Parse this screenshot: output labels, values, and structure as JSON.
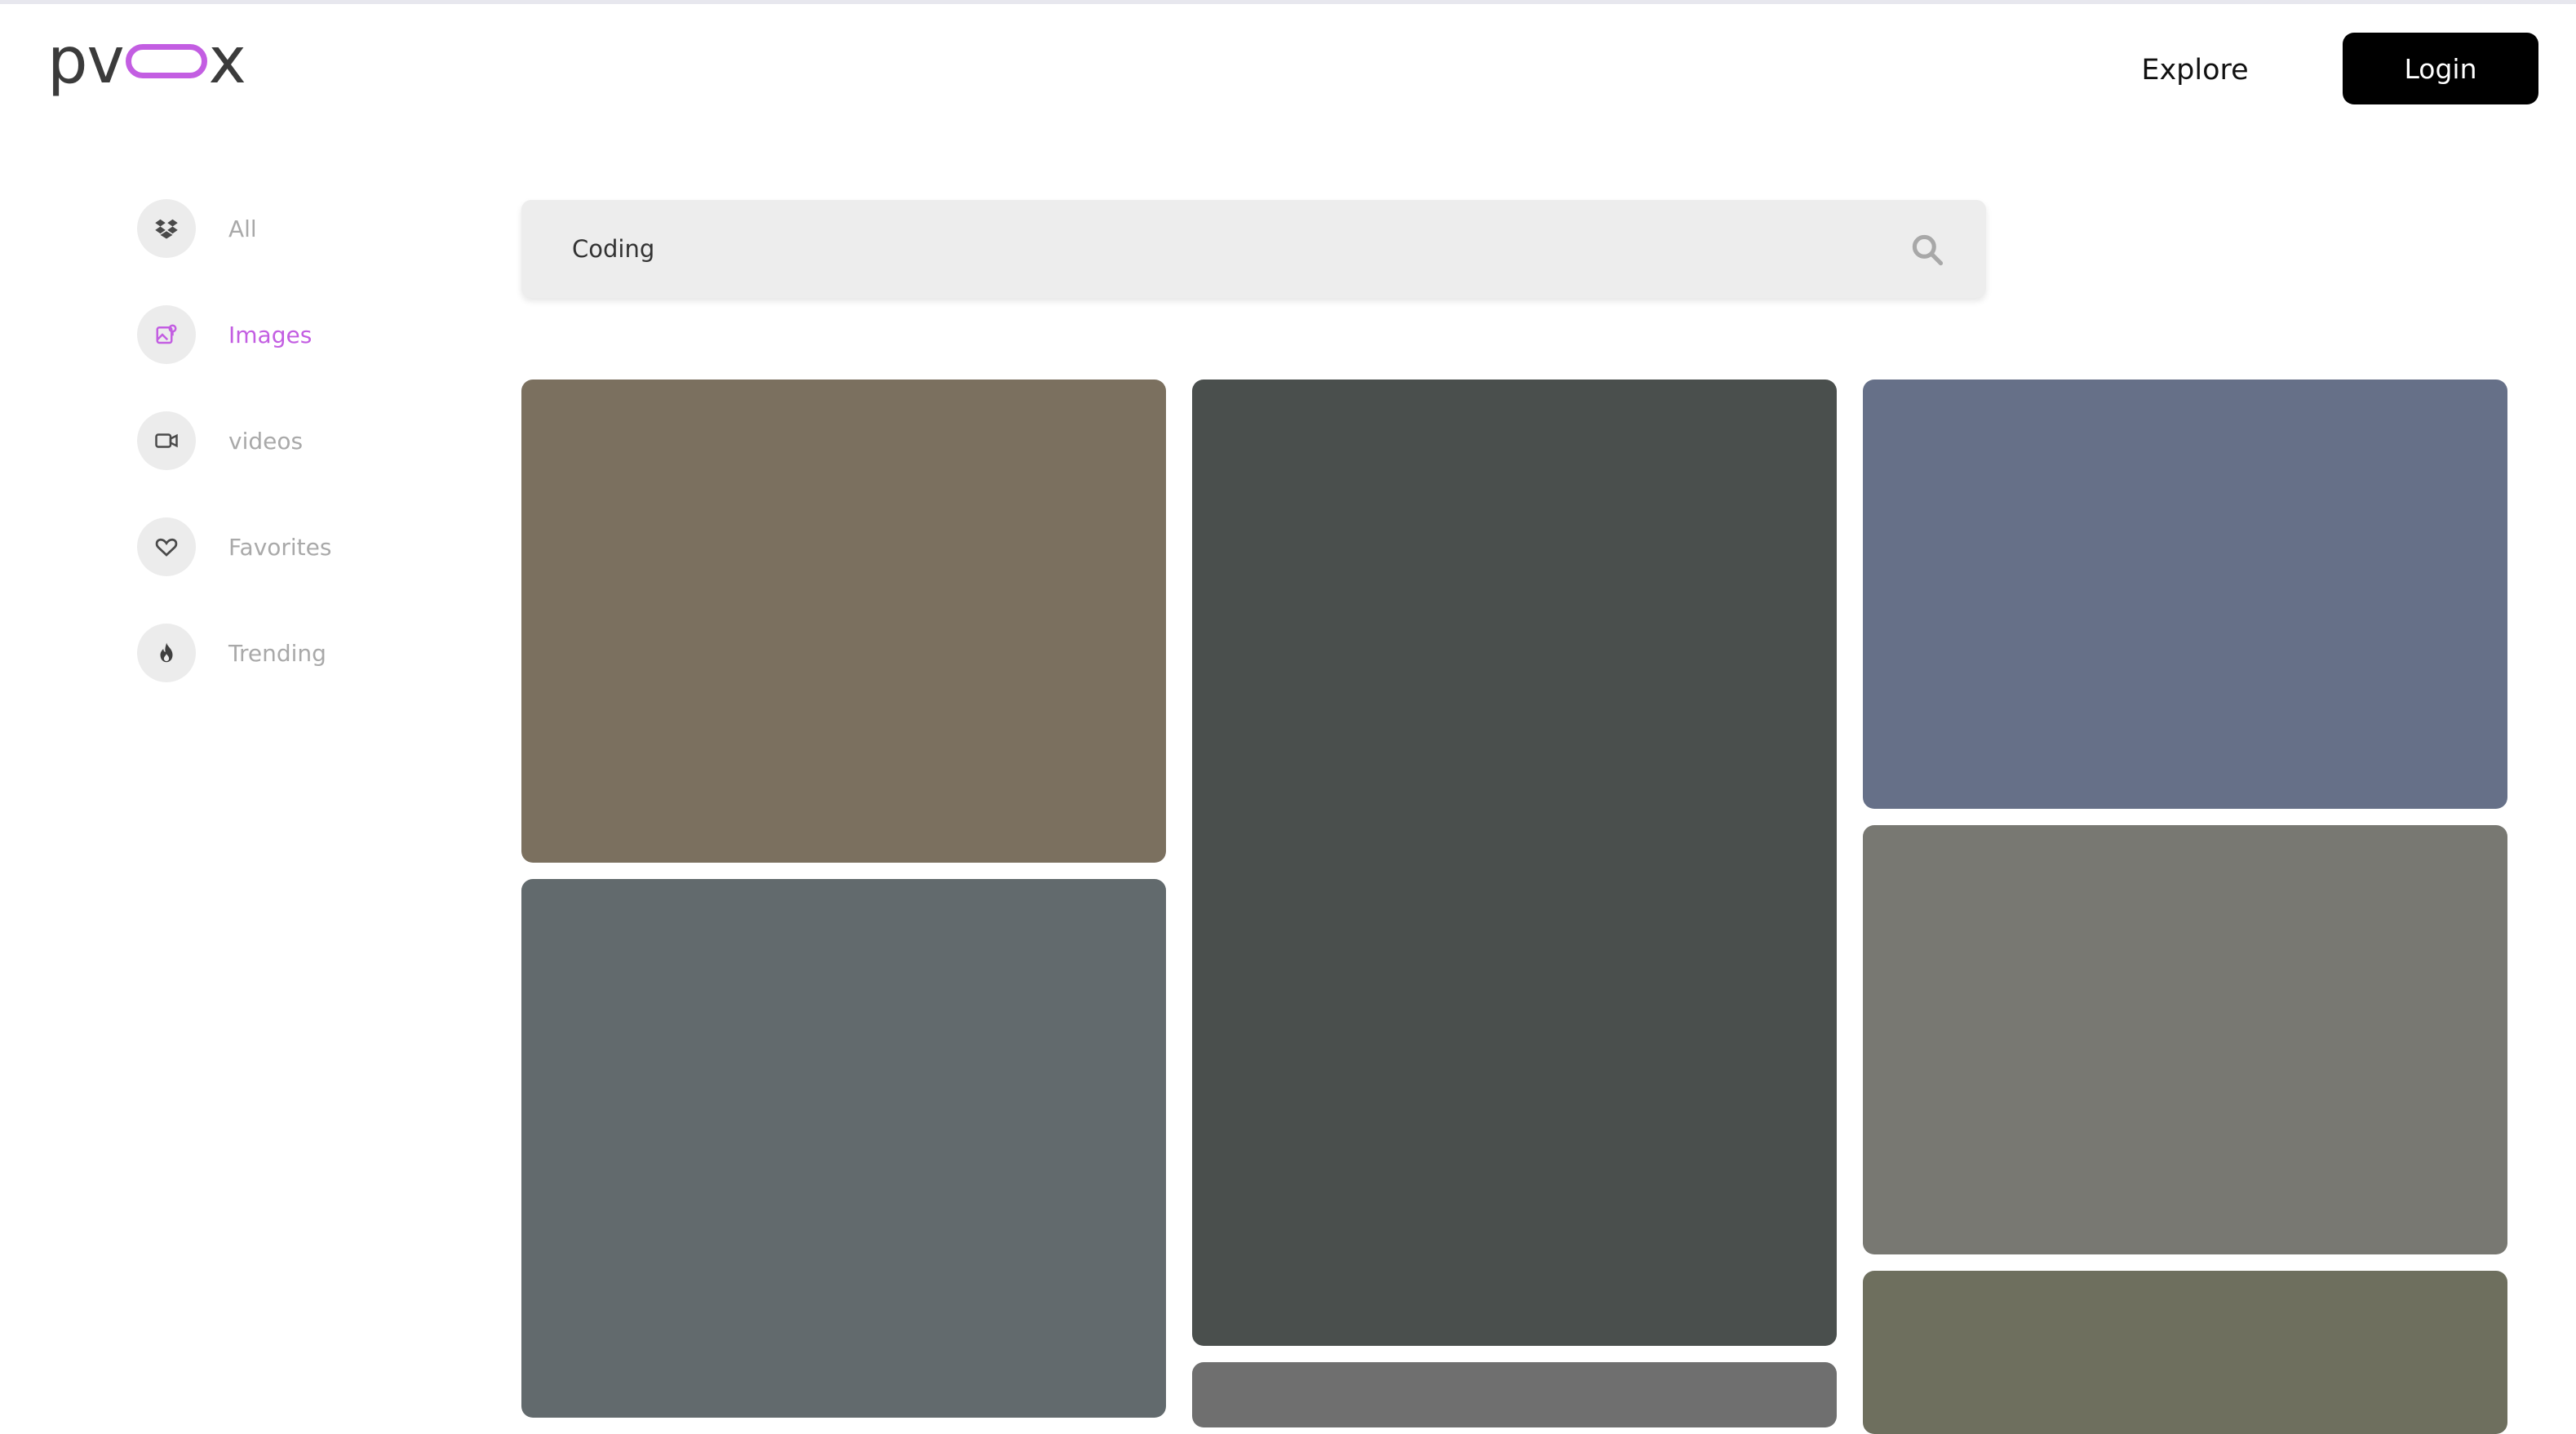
{
  "logo": {
    "prefix": "pv",
    "suffix": "x",
    "accent": "#c35ee2"
  },
  "header": {
    "explore_label": "Explore",
    "login_label": "Login"
  },
  "sidebar": {
    "items": [
      {
        "label": "All",
        "icon": "dropbox-icon"
      },
      {
        "label": "Images",
        "icon": "image-icon",
        "active": true
      },
      {
        "label": "videos",
        "icon": "video-icon"
      },
      {
        "label": "Favorites",
        "icon": "heart-icon"
      },
      {
        "label": "Trending",
        "icon": "fire-icon"
      }
    ]
  },
  "search": {
    "value": "Coding",
    "icon": "search-icon"
  },
  "gallery": {
    "tiles": [
      {
        "color": "#7b705f"
      },
      {
        "color": "#626a6d"
      },
      {
        "color": "#4a4f4d"
      },
      {
        "color": "#6f6f6f"
      },
      {
        "color": "#667088"
      },
      {
        "color": "#787872"
      },
      {
        "color": "#6e6f5e"
      }
    ]
  }
}
